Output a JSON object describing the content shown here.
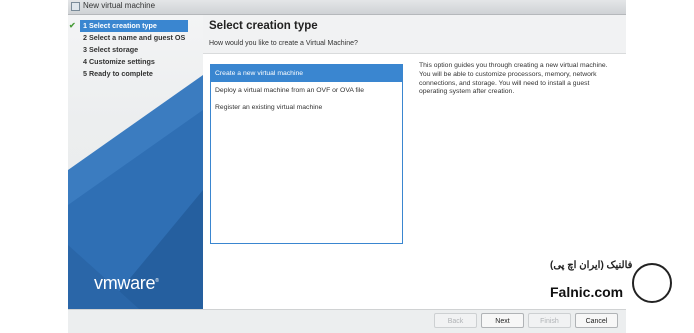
{
  "window": {
    "title": "New virtual machine"
  },
  "steps": [
    {
      "label": "1 Select creation type",
      "done": true,
      "active": true
    },
    {
      "label": "2 Select a name and guest OS"
    },
    {
      "label": "3 Select storage"
    },
    {
      "label": "4 Customize settings"
    },
    {
      "label": "5 Ready to complete"
    }
  ],
  "brand": {
    "logo_text": "vmware",
    "trademark": "®"
  },
  "page": {
    "title": "Select creation type",
    "subtitle": "How would you like to create a Virtual Machine?"
  },
  "options": [
    {
      "label": "Create a new virtual machine",
      "selected": true
    },
    {
      "label": "Deploy a virtual machine from an OVF or OVA file"
    },
    {
      "label": "Register an existing virtual machine"
    }
  ],
  "description": "This option guides you through creating a new virtual machine. You will be able to customize processors, memory, network connections, and storage. You will need to install a guest operating system after creation.",
  "buttons": {
    "back": "Back",
    "next": "Next",
    "finish": "Finish",
    "cancel": "Cancel"
  },
  "watermark": {
    "persian": "فالنیک (ایران اچ پی)",
    "latin": "Falnic.com"
  },
  "colors": {
    "accent": "#3a86d0",
    "panel_blue": "#2f6fb4"
  }
}
